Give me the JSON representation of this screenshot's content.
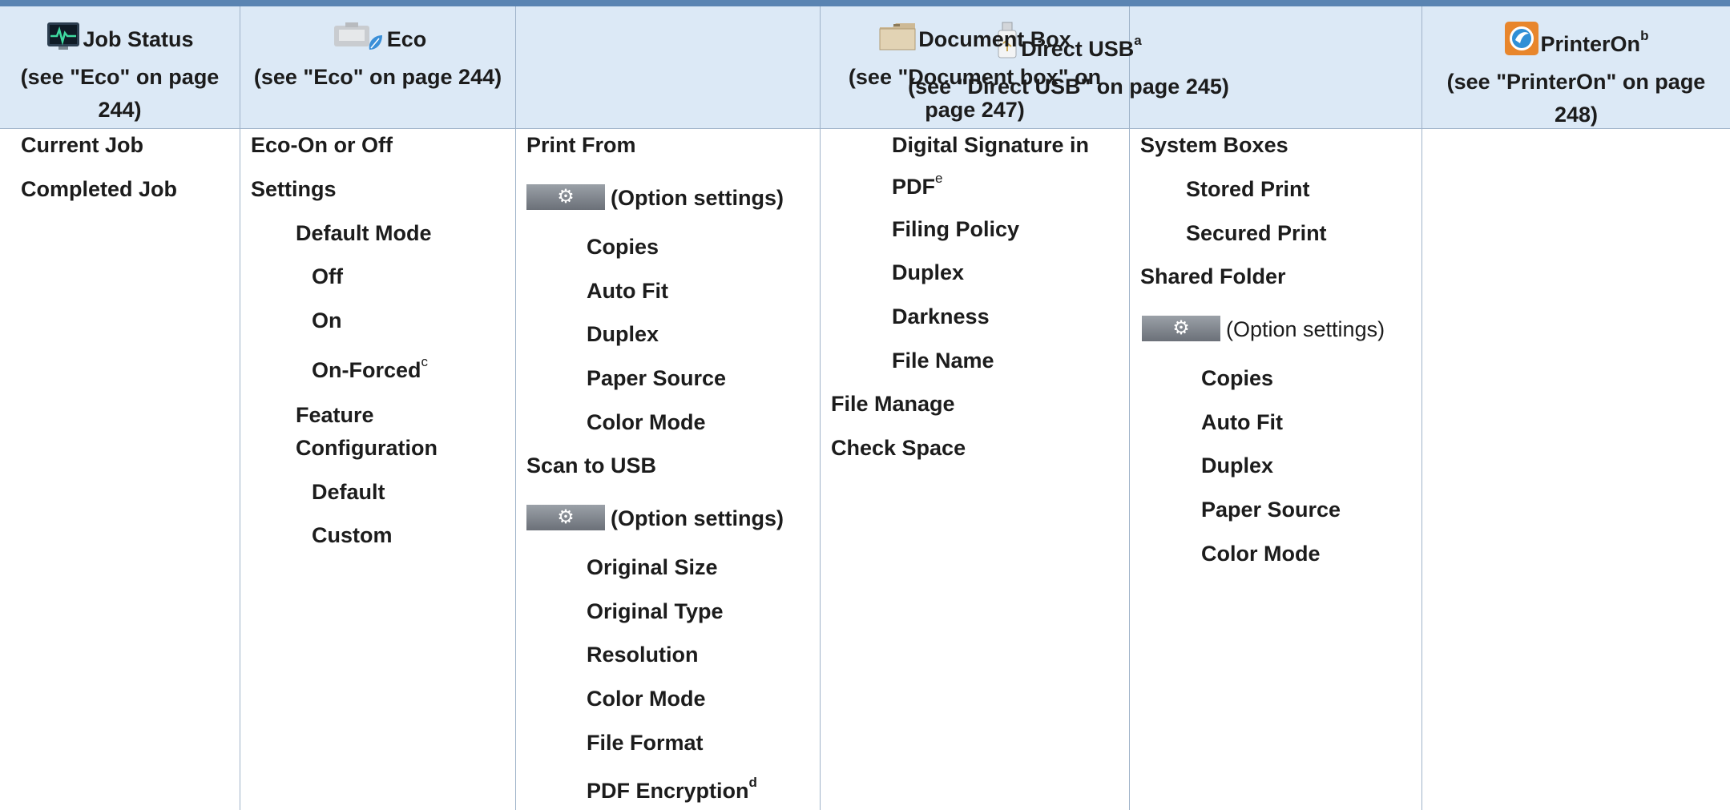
{
  "header": {
    "job_status": {
      "title": "Job Status",
      "sub": "(see \"Eco\" on page 244)",
      "icon": "job-status-monitor-icon"
    },
    "eco": {
      "title": "Eco",
      "sub": "(see \"Eco\" on page 244)",
      "icon": "eco-leaf-icon"
    },
    "direct_usb": {
      "title": "Direct USB",
      "sup": "a",
      "sub": "(see \"Direct USB\" on page 245)",
      "icon": "usb-drive-icon"
    },
    "document_box": {
      "title": "Document Box",
      "sub": "(see \"Document box\" on page 247)",
      "icon": "folder-box-icon"
    },
    "printeron": {
      "title": "PrinterOn",
      "sup": "b",
      "sub": "(see \"PrinterOn\" on page 248)",
      "icon": "printeron-logo-icon"
    }
  },
  "job_status": {
    "current_job": "Current Job",
    "completed_job": "Completed Job"
  },
  "eco": {
    "eco_on_off": "Eco-On or Off",
    "settings": "Settings",
    "default_mode": "Default Mode",
    "off": "Off",
    "on": "On",
    "on_forced": "On-Forced",
    "on_forced_sup": "c",
    "feature": "Feature",
    "configuration": "Configuration",
    "default": "Default",
    "custom": "Custom"
  },
  "usb_left": {
    "print_from": "Print From",
    "print_option": "(Option settings)",
    "copies": "Copies",
    "auto_fit": "Auto Fit",
    "duplex": "Duplex",
    "paper_source": "Paper Source",
    "color_mode": "Color Mode",
    "scan_to_usb": "Scan to USB",
    "scan_option": "(Option settings)",
    "original_size": "Original Size",
    "original_type": "Original Type",
    "resolution": "Resolution",
    "scan_color_mode": "Color Mode",
    "file_format": "File Format",
    "pdf_encryption": "PDF Encryption",
    "pdf_encryption_sup": "d"
  },
  "usb_right": {
    "digital_signature_1": "Digital Signature in",
    "digital_signature_2": "PDF",
    "digital_signature_sup": "e",
    "filing_policy": "Filing Policy",
    "duplex": "Duplex",
    "darkness": "Darkness",
    "file_name": "File Name",
    "file_manage": "File Manage",
    "check_space": "Check Space"
  },
  "docbox": {
    "system_boxes": "System Boxes",
    "stored_print": "Stored Print",
    "secured_print": "Secured Print",
    "shared_folder": "Shared Folder",
    "option": "(Option settings)",
    "copies": "Copies",
    "auto_fit": "Auto Fit",
    "duplex": "Duplex",
    "paper_source": "Paper Source",
    "color_mode": "Color Mode"
  },
  "colors": {
    "header_bg": "#dce9f6",
    "top_rule": "#5a84b2",
    "grid": "#9fb3c9"
  }
}
